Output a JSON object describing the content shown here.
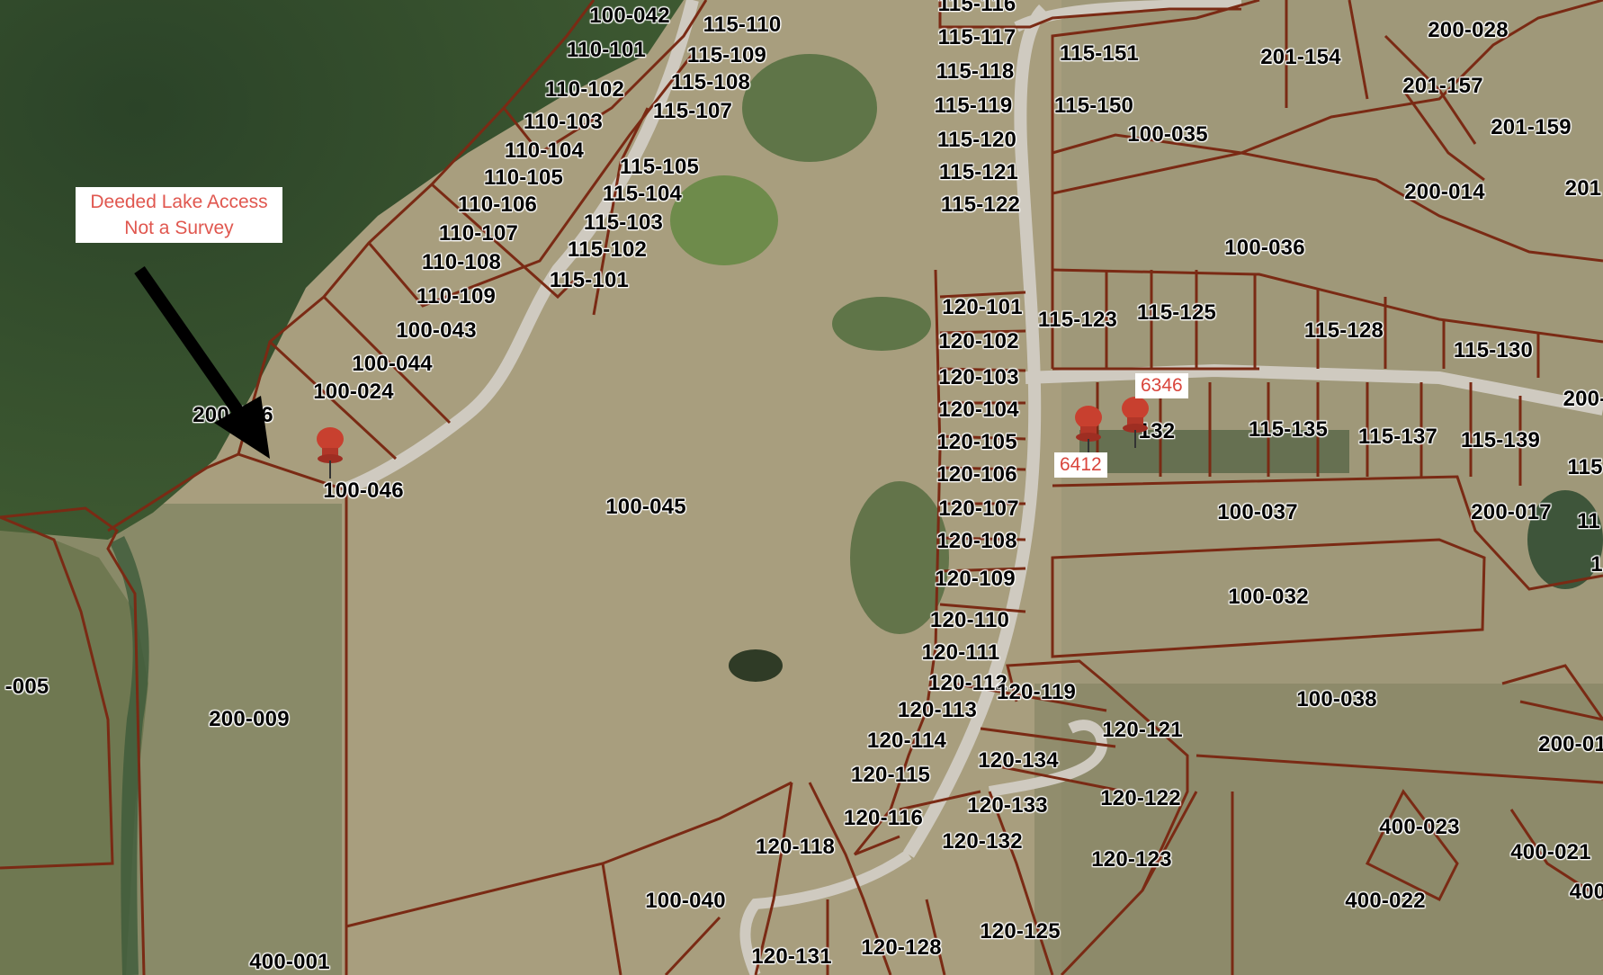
{
  "callout": {
    "line1": "Deeded Lake Access",
    "line2": "Not a Survey"
  },
  "pins": [
    {
      "address": "6346"
    },
    {
      "address": "6412"
    },
    {
      "address": ""
    }
  ],
  "colors": {
    "parcel_line": "#7a2a14",
    "road": "#c9c4bc",
    "lake": "#2f4a2a",
    "pin": "#c8402f",
    "callout_text": "#e0574f"
  },
  "parcels": [
    "100-042",
    "110-101",
    "110-102",
    "110-103",
    "110-104",
    "110-105",
    "110-106",
    "110-107",
    "110-108",
    "110-109",
    "100-043",
    "100-044",
    "100-024",
    "200-006",
    "100-046",
    "115-110",
    "115-109",
    "115-108",
    "115-107",
    "115-105",
    "115-104",
    "115-103",
    "115-102",
    "115-101",
    "115-116",
    "115-117",
    "115-118",
    "115-119",
    "115-120",
    "115-121",
    "115-122",
    "120-101",
    "120-102",
    "120-103",
    "120-104",
    "120-105",
    "120-106",
    "120-107",
    "120-108",
    "120-109",
    "120-110",
    "120-111",
    "120-112",
    "120-113",
    "120-114",
    "120-115",
    "120-116",
    "120-118",
    "120-119",
    "120-121",
    "120-134",
    "120-133",
    "120-132",
    "120-122",
    "120-123",
    "120-125",
    "120-128",
    "120-131",
    "115-151",
    "115-150",
    "100-035",
    "201-154",
    "200-028",
    "201-157",
    "201-159",
    "200-014",
    "201",
    "100-036",
    "115-123",
    "115-125",
    "115-128",
    "115-130",
    "200-",
    "132",
    "115-135",
    "115-137",
    "115-139",
    "115",
    "100-037",
    "200-017",
    "11",
    "100-032",
    "1",
    "100-045",
    "100-038",
    "200-01",
    "400-023",
    "400-021",
    "400",
    "400-022",
    "-005",
    "200-009",
    "100-040",
    "400-001"
  ]
}
